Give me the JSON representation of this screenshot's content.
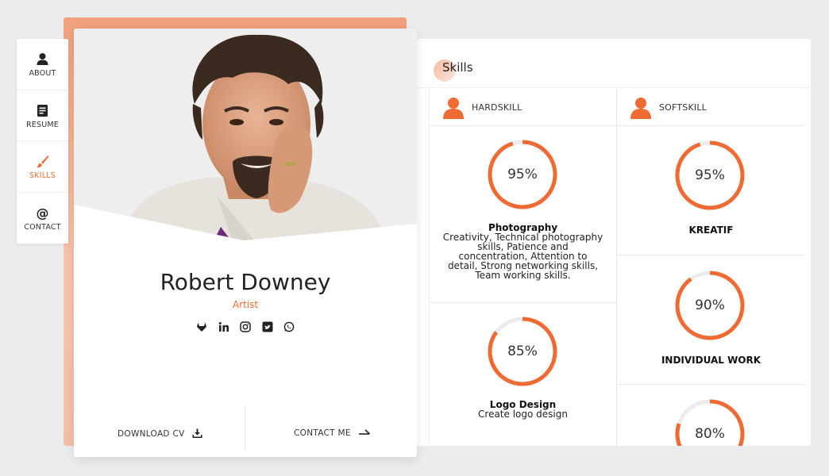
{
  "nav": {
    "items": [
      {
        "label": "ABOUT",
        "icon": "user-icon"
      },
      {
        "label": "RESUME",
        "icon": "document-icon"
      },
      {
        "label": "SKILLS",
        "icon": "brush-icon"
      },
      {
        "label": "CONTACT",
        "icon": "at-icon"
      }
    ],
    "active": "SKILLS"
  },
  "profile": {
    "name": "Robert Downey",
    "role": "Artist",
    "socials": [
      "gitlab-icon",
      "linkedin-icon",
      "instagram-icon",
      "twitter-icon",
      "whatsapp-icon"
    ],
    "download_label": "DOWNLOAD CV",
    "contact_label": "CONTACT ME"
  },
  "skills": {
    "title": "Skills",
    "hard": {
      "heading": "HARDSKILL",
      "items": [
        {
          "percent": "95%",
          "value": 95,
          "name": "Photography",
          "desc": "Creativity, Technical photography skills, Patience and concentration, Attention to detail, Strong networking skills, Team working skills."
        },
        {
          "percent": "85%",
          "value": 85,
          "name": "Logo Design",
          "desc": "Create logo design"
        }
      ]
    },
    "soft": {
      "heading": "SOFTSKILL",
      "items": [
        {
          "percent": "95%",
          "value": 95,
          "name": "KREATIF"
        },
        {
          "percent": "90%",
          "value": 90,
          "name": "INDIVIDUAL WORK"
        },
        {
          "percent": "80%",
          "value": 80,
          "name": ""
        }
      ]
    }
  },
  "colors": {
    "accent": "#ef6b33",
    "ring_track": "#ececec"
  }
}
